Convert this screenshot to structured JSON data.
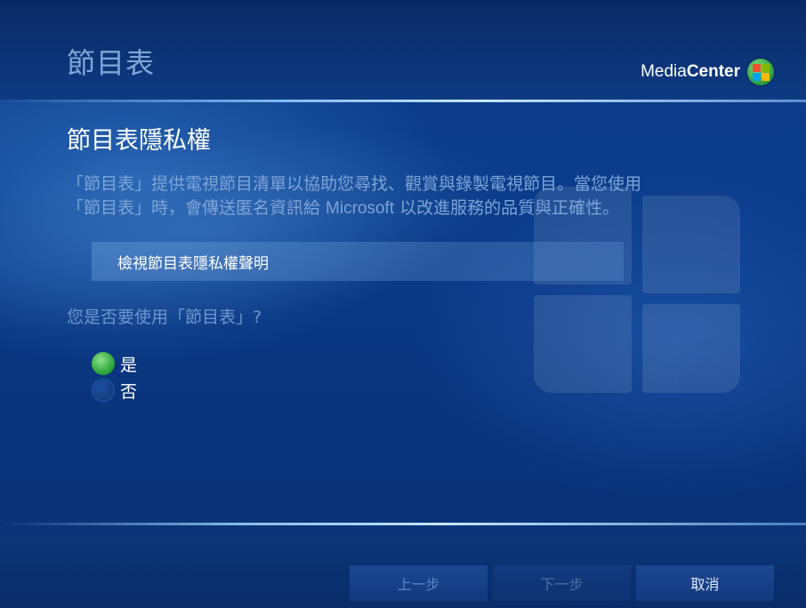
{
  "header": {
    "title": "節目表",
    "brand_media": "Media",
    "brand_center": "Center",
    "brand_logo_icon": "windows-flag-icon"
  },
  "main": {
    "title": "節目表隱私權",
    "description_line1": "「節目表」提供電視節目清單以協助您尋找、觀賞與錄製電視節目。當您使用",
    "description_line2_a": "「節目表」時，會傳送匿名資訊給 ",
    "description_line2_ms": "Microsoft",
    "description_line2_b": " 以改進服務的品質與正確性。",
    "privacy_button_label": "檢視節目表隱私權聲明",
    "question": "您是否要使用「節目表」?",
    "options": [
      {
        "label": "是",
        "selected": true
      },
      {
        "label": "否",
        "selected": false
      }
    ]
  },
  "footer": {
    "back_label": "上一步",
    "next_label": "下一步",
    "cancel_label": "取消"
  },
  "colors": {
    "background": "#0b3d8c",
    "radio_selected": "#2faa3c",
    "text_muted": "#7da4d6"
  }
}
